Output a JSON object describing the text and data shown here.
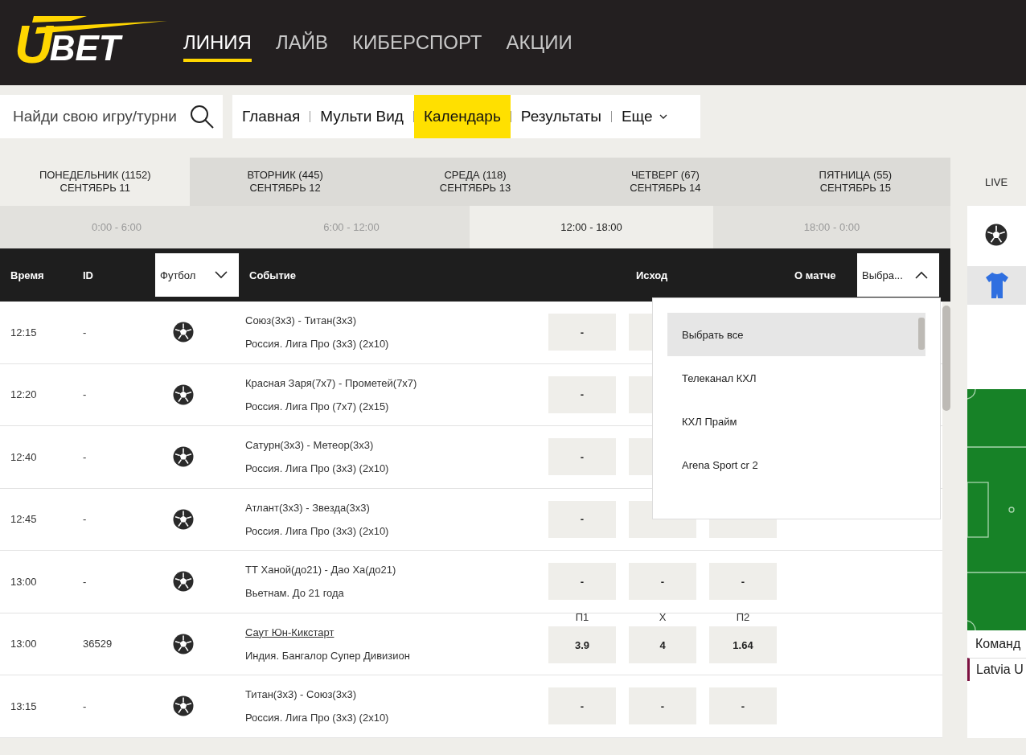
{
  "logo": {
    "mark": "U",
    "text": "BET"
  },
  "nav": [
    {
      "label": "ЛИНИЯ",
      "selected": true
    },
    {
      "label": "ЛАЙВ",
      "selected": false
    },
    {
      "label": "КИБЕРСПОРТ",
      "selected": false
    },
    {
      "label": "АКЦИИ",
      "selected": false
    }
  ],
  "search": {
    "placeholder": "Найди свою игру/турни"
  },
  "menu": [
    {
      "label": "Главная",
      "selected": false,
      "dropdown": false
    },
    {
      "label": "Мульти Вид",
      "selected": false,
      "dropdown": false
    },
    {
      "label": "Календарь",
      "selected": true,
      "dropdown": false
    },
    {
      "label": "Результаты",
      "selected": false,
      "dropdown": false
    },
    {
      "label": "Еще",
      "selected": false,
      "dropdown": true
    }
  ],
  "days": [
    {
      "day": "ПОНЕДЕЛЬНИК (1152)",
      "date": "СЕНТЯБРЬ 11",
      "selected": true
    },
    {
      "day": "ВТОРНИК (445)",
      "date": "СЕНТЯБРЬ 12",
      "selected": false
    },
    {
      "day": "СРЕДА (118)",
      "date": "СЕНТЯБРЬ 13",
      "selected": false
    },
    {
      "day": "ЧЕТВЕРГ (67)",
      "date": "СЕНТЯБРЬ 14",
      "selected": false
    },
    {
      "day": "ПЯТНИЦА (55)",
      "date": "СЕНТЯБРЬ 15",
      "selected": false
    }
  ],
  "time_ranges": [
    {
      "label": "0:00 - 6:00",
      "selected": false
    },
    {
      "label": "6:00 - 12:00",
      "selected": false
    },
    {
      "label": "12:00 - 18:00",
      "selected": true
    },
    {
      "label": "18:00 - 0:00",
      "selected": false
    }
  ],
  "table": {
    "columns": {
      "time": "Время",
      "id": "ID",
      "sport": "Футбол",
      "event": "Событие",
      "outcome": "Исход",
      "about": "О матче",
      "broadcast": "Выбра..."
    },
    "broadcast_dropdown": {
      "expanded": true,
      "items": [
        {
          "label": "Выбрать все",
          "selected": true
        },
        {
          "label": "Телеканал КХЛ",
          "selected": false
        },
        {
          "label": "КХЛ Прайм",
          "selected": false
        },
        {
          "label": "Arena Sport cr 2",
          "selected": false
        }
      ]
    },
    "rows": [
      {
        "time": "12:15",
        "id": "-",
        "event": "Союз(3х3) - Титан(3х3)",
        "league": "Россия. Лига Про (3х3) (2х10)",
        "linked": false,
        "covered": true,
        "odds": [
          "-"
        ]
      },
      {
        "time": "12:20",
        "id": "-",
        "event": "Красная Заря(7х7) - Прометей(7х7)",
        "league": "Россия. Лига Про (7х7) (2х15)",
        "linked": false,
        "covered": true,
        "odds": [
          "-"
        ]
      },
      {
        "time": "12:40",
        "id": "-",
        "event": "Сатурн(3х3) - Метеор(3х3)",
        "league": "Россия. Лига Про (3х3) (2х10)",
        "linked": false,
        "covered": true,
        "odds": [
          "-"
        ]
      },
      {
        "time": "12:45",
        "id": "-",
        "event": "Атлант(3х3) - Звезда(3х3)",
        "league": "Россия. Лига Про (3х3) (2х10)",
        "linked": false,
        "covered": false,
        "odds": [
          "-"
        ]
      },
      {
        "time": "13:00",
        "id": "-",
        "event": "ТТ Ханой(до21) - Дао Ха(до21)",
        "league": "Вьетнам. До 21 года",
        "linked": false,
        "odds": [
          "-",
          "-",
          "-"
        ]
      },
      {
        "time": "13:00",
        "id": "36529",
        "event": "Саут Юн-Кикстарт",
        "league": "Индия. Бангалор Супер Дивизион",
        "linked": true,
        "odds_labels": [
          "П1",
          "Х",
          "П2"
        ],
        "odds": [
          "3.9",
          "4",
          "1.64"
        ]
      },
      {
        "time": "13:15",
        "id": "-",
        "event": "Титан(3х3) - Союз(3х3)",
        "league": "Россия. Лига Про (3х3) (2х10)",
        "linked": false,
        "odds": [
          "-",
          "-",
          "-"
        ]
      }
    ]
  },
  "live_panel": {
    "title": "LIVE",
    "teams_header": "Команд",
    "teams": [
      {
        "name": "Latvia U",
        "selected": true
      }
    ]
  }
}
